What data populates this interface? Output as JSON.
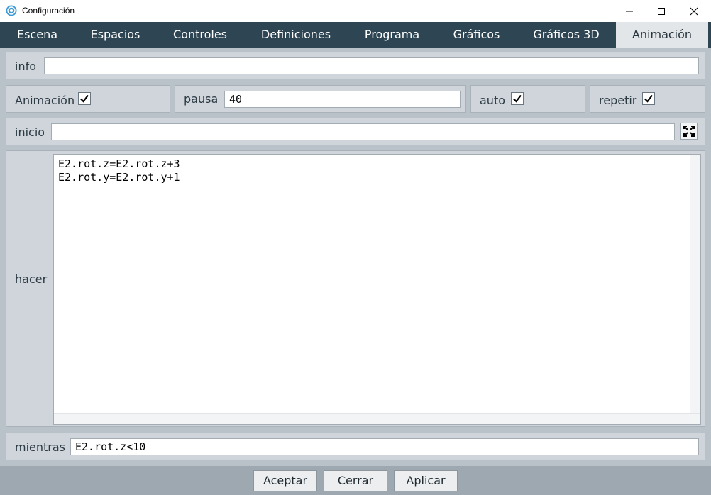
{
  "window": {
    "title": "Configuración"
  },
  "tabs": [
    {
      "label": "Escena"
    },
    {
      "label": "Espacios"
    },
    {
      "label": "Controles"
    },
    {
      "label": "Definiciones"
    },
    {
      "label": "Programa"
    },
    {
      "label": "Gráficos"
    },
    {
      "label": "Gráficos 3D"
    },
    {
      "label": "Animación",
      "active": true
    }
  ],
  "info": {
    "label": "info",
    "value": ""
  },
  "options": {
    "animacion": {
      "label": "Animación",
      "checked": true
    },
    "pausa": {
      "label": "pausa",
      "value": "40"
    },
    "auto": {
      "label": "auto",
      "checked": true
    },
    "repetir": {
      "label": "repetir",
      "checked": true
    }
  },
  "inicio": {
    "label": "inicio",
    "value": "",
    "expand_icon": "expand-arrows-icon"
  },
  "hacer": {
    "label": "hacer",
    "lines": [
      "E2.rot.z=E2.rot.z+3",
      "E2.rot.y=E2.rot.y+1"
    ]
  },
  "mientras": {
    "label": "mientras",
    "value": "E2.rot.z<10"
  },
  "footer": {
    "aceptar": "Aceptar",
    "cerrar": "Cerrar",
    "aplicar": "Aplicar"
  },
  "colors": {
    "tabbar": "#2e4553",
    "active_tab": "#e2e6e9",
    "panel": "#cfd5da",
    "background": "#bac2c9"
  }
}
